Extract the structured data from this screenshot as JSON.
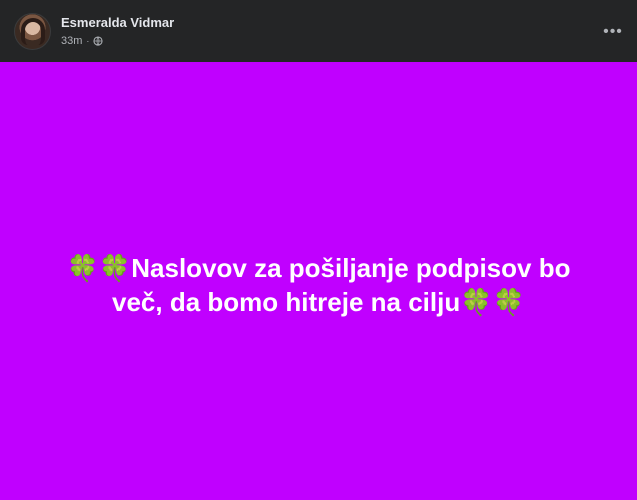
{
  "post": {
    "author": {
      "name": "Esmeralda Vidmar",
      "avatar_icon": "profile-photo-icon"
    },
    "meta": {
      "time": "33m",
      "separator": "·",
      "audience_icon": "globe-icon"
    },
    "more_button": {
      "label": "•••"
    },
    "status": {
      "text": "🍀🍀Naslovov za pošiljanje podpisov bo več, da bomo hitreje na cilju🍀🍀"
    },
    "colors": {
      "header_background": "#242526",
      "text_background": "#c000ff",
      "text": "#ffffff"
    }
  }
}
